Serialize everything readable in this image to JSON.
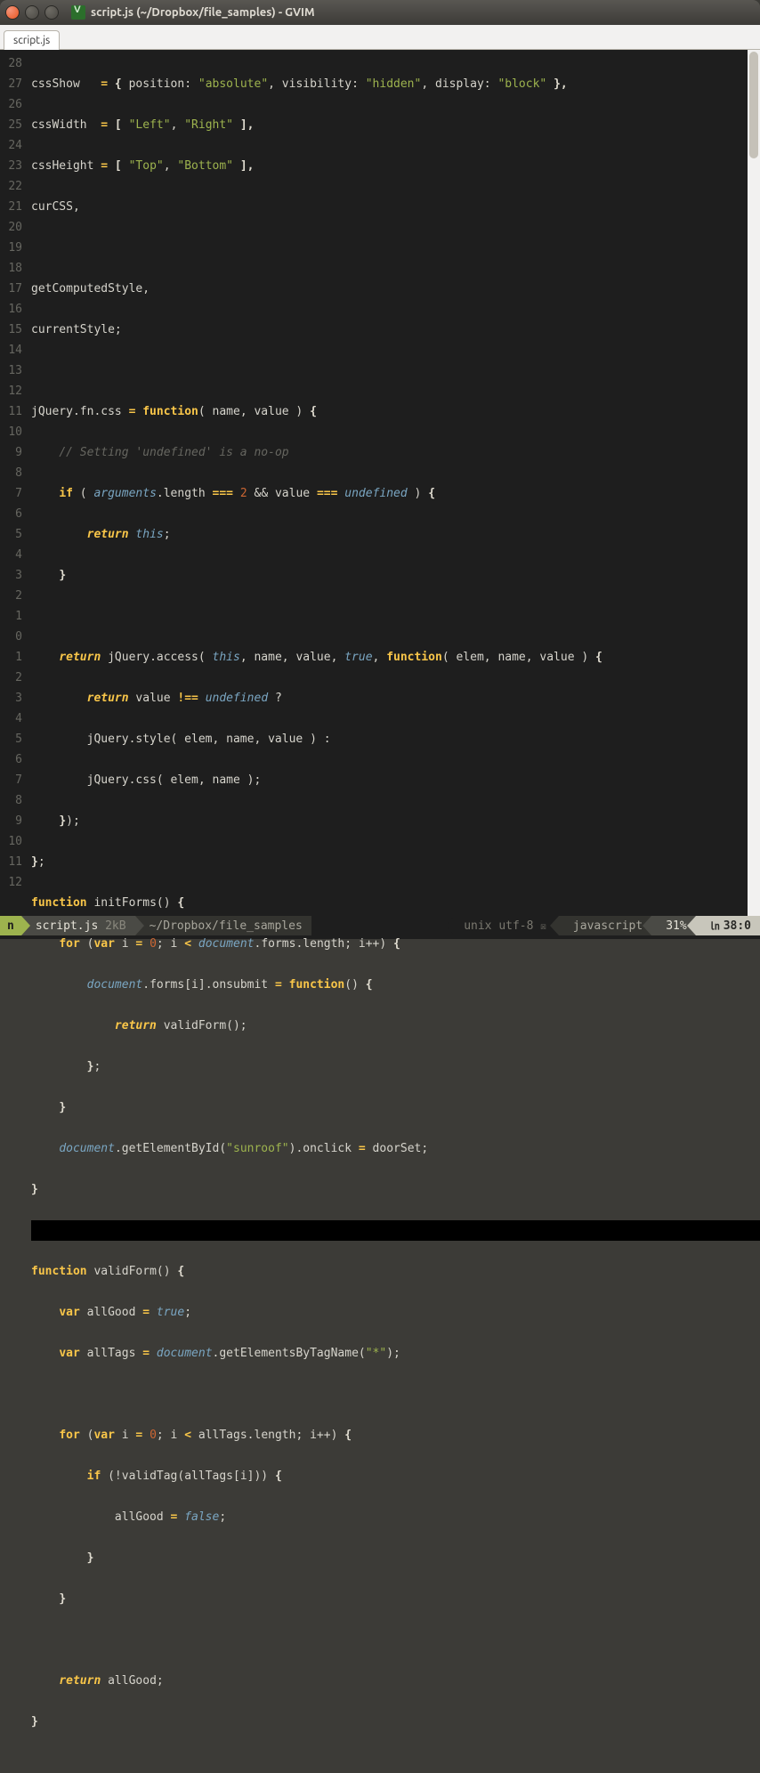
{
  "window": {
    "title": "script.js (~/Dropbox/file_samples) - GVIM"
  },
  "tab": {
    "label": "script.js"
  },
  "gutter": [
    "28",
    "27",
    "26",
    "25",
    "24",
    "23",
    "22",
    "21",
    "20",
    "19",
    "18",
    "17",
    "16",
    "15",
    "14",
    "13",
    "12",
    "11",
    "10",
    "9",
    "8",
    "7",
    "6",
    "5",
    "4",
    "3",
    "2",
    "1",
    "0",
    "1",
    "2",
    "3",
    "4",
    "5",
    "6",
    "7",
    "8",
    "9",
    "10",
    "11",
    "12"
  ],
  "code": {
    "l0": {
      "a": "cssShow   ",
      "b": "=",
      "c": " { ",
      "d": "position:",
      "e": " \"absolute\"",
      "f": ", ",
      "g": "visibility:",
      "h": " \"hidden\"",
      "i": ", ",
      "j": "display:",
      "k": " \"block\"",
      "l": " },"
    },
    "l1": {
      "a": "cssWidth  ",
      "b": "=",
      "c": " [ ",
      "d": "\"Left\"",
      "e": ", ",
      "f": "\"Right\"",
      "g": " ],"
    },
    "l2": {
      "a": "cssHeight ",
      "b": "=",
      "c": " [ ",
      "d": "\"Top\"",
      "e": ", ",
      "f": "\"Bottom\"",
      "g": " ],"
    },
    "l3": {
      "a": "curCSS,"
    },
    "l4": {
      "a": ""
    },
    "l5": {
      "a": "getComputedStyle,"
    },
    "l6": {
      "a": "currentStyle;"
    },
    "l7": {
      "a": ""
    },
    "l8": {
      "a": "jQuery.fn.css ",
      "b": "=",
      "c": " ",
      "d": "function",
      "e": "( name, value ) ",
      "f": "{"
    },
    "l9": {
      "a": "    ",
      "b": "// Setting 'undefined' is a no-op"
    },
    "l10": {
      "a": "    ",
      "b": "if",
      "c": " ( ",
      "d": "arguments",
      "e": ".length ",
      "f": "===",
      "g": " ",
      "h": "2",
      "i": " && value ",
      "j": "===",
      "k": " ",
      "l": "undefined",
      "m": " ) ",
      "n": "{"
    },
    "l11": {
      "a": "        ",
      "b": "return",
      "c": " ",
      "d": "this",
      "e": ";"
    },
    "l12": {
      "a": "    ",
      "b": "}"
    },
    "l13": {
      "a": ""
    },
    "l14": {
      "a": "    ",
      "b": "return",
      "c": " jQuery.access( ",
      "d": "this",
      "e": ", name, value, ",
      "f": "true",
      "g": ", ",
      "h": "function",
      "i": "( elem, name, value ) ",
      "j": "{"
    },
    "l15": {
      "a": "        ",
      "b": "return",
      "c": " value ",
      "d": "!==",
      "e": " ",
      "f": "undefined",
      "g": " ?"
    },
    "l16": {
      "a": "        jQuery.style( elem, name, value ) :"
    },
    "l17": {
      "a": "        jQuery.css( elem, name );"
    },
    "l18": {
      "a": "    ",
      "b": "}",
      "c": ");"
    },
    "l19": {
      "a": "}",
      "b": ";"
    },
    "l20": {
      "a": "function",
      "b": " initForms() ",
      "c": "{"
    },
    "l21": {
      "a": "    ",
      "b": "for",
      "c": " (",
      "d": "var",
      "e": " i ",
      "f": "=",
      "g": " ",
      "h": "0",
      "i": "; i ",
      "j": "<",
      "k": " ",
      "l": "document",
      "m": ".forms.length; i++) ",
      "n": "{"
    },
    "l22": {
      "a": "        ",
      "b": "document",
      "c": ".forms[i].onsubmit ",
      "d": "=",
      "e": " ",
      "f": "function",
      "g": "() ",
      "h": "{"
    },
    "l23": {
      "a": "            ",
      "b": "return",
      "c": " validForm();"
    },
    "l24": {
      "a": "        ",
      "b": "}",
      "c": ";"
    },
    "l25": {
      "a": "    ",
      "b": "}"
    },
    "l26": {
      "a": "    ",
      "b": "document",
      "c": ".getElementById(",
      "d": "\"sunroof\"",
      "e": ").onclick ",
      "f": "=",
      "g": " doorSet;"
    },
    "l27": {
      "a": "}"
    },
    "l28": {
      "a": ""
    },
    "l29": {
      "a": "function",
      "b": " validForm() ",
      "c": "{"
    },
    "l30": {
      "a": "    ",
      "b": "var",
      "c": " allGood ",
      "d": "=",
      "e": " ",
      "f": "true",
      "g": ";"
    },
    "l31": {
      "a": "    ",
      "b": "var",
      "c": " allTags ",
      "d": "=",
      "e": " ",
      "f": "document",
      "g": ".getElementsByTagName(",
      "h": "\"*\"",
      "i": ");"
    },
    "l32": {
      "a": ""
    },
    "l33": {
      "a": "    ",
      "b": "for",
      "c": " (",
      "d": "var",
      "e": " i ",
      "f": "=",
      "g": " ",
      "h": "0",
      "i": "; i ",
      "j": "<",
      "k": " allTags.length; i++) ",
      "l": "{"
    },
    "l34": {
      "a": "        ",
      "b": "if",
      "c": " (!validTag(allTags[i])) ",
      "d": "{"
    },
    "l35": {
      "a": "            allGood ",
      "b": "=",
      "c": " ",
      "d": "false",
      "e": ";"
    },
    "l36": {
      "a": "        ",
      "b": "}"
    },
    "l37": {
      "a": "    ",
      "b": "}"
    },
    "l38": {
      "a": ""
    },
    "l39": {
      "a": "    ",
      "b": "return",
      "c": " allGood;"
    },
    "l40": {
      "a": "}"
    }
  },
  "status": {
    "mode": "n",
    "filename": "script.js",
    "filesize": "2kB",
    "path": "~/Dropbox/file_samples",
    "encoding": "unix utf-8",
    "ro_glyph": "☒",
    "filetype": "javascript",
    "percent": "31%",
    "ln_glyph": "㏑",
    "position": "38:0"
  }
}
